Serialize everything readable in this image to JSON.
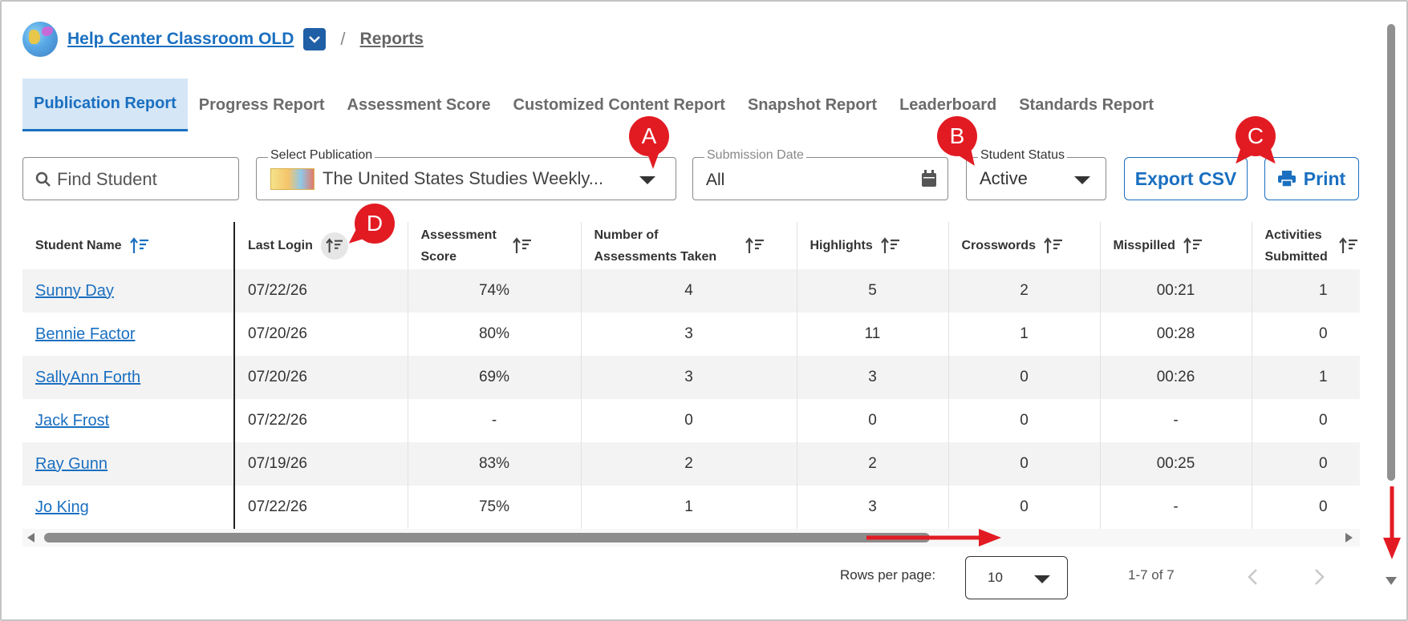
{
  "breadcrumb": {
    "classroom": "Help Center Classroom OLD",
    "separator": "/",
    "reports": "Reports"
  },
  "tabs": [
    {
      "label": "Publication Report",
      "active": true
    },
    {
      "label": "Progress Report"
    },
    {
      "label": "Assessment Score"
    },
    {
      "label": "Customized Content Report"
    },
    {
      "label": "Snapshot Report"
    },
    {
      "label": "Leaderboard"
    },
    {
      "label": "Standards Report"
    }
  ],
  "filters": {
    "search_placeholder": "Find Student",
    "publication_label": "Select Publication",
    "publication_value": "The United States Studies Weekly...",
    "date_label": "Submission Date",
    "date_value": "All",
    "status_label": "Student Status",
    "status_value": "Active"
  },
  "actions": {
    "export": "Export CSV",
    "print": "Print"
  },
  "table": {
    "headers": [
      "Student Name",
      "Last Login",
      "Assessment Score",
      "Number of Assessments Taken",
      "Highlights",
      "Crosswords",
      "Misspilled",
      "Activities Submitted"
    ],
    "rows": [
      [
        "Sunny Day",
        "07/22/26",
        "74%",
        "4",
        "5",
        "2",
        "00:21",
        "1"
      ],
      [
        "Bennie Factor",
        "07/20/26",
        "80%",
        "3",
        "11",
        "1",
        "00:28",
        "0"
      ],
      [
        "SallyAnn Forth",
        "07/20/26",
        "69%",
        "3",
        "3",
        "0",
        "00:26",
        "1"
      ],
      [
        "Jack Frost",
        "07/22/26",
        "-",
        "0",
        "0",
        "0",
        "-",
        "0"
      ],
      [
        "Ray Gunn",
        "07/19/26",
        "83%",
        "2",
        "2",
        "0",
        "00:25",
        "0"
      ],
      [
        "Jo King",
        "07/22/26",
        "75%",
        "1",
        "3",
        "0",
        "-",
        "0"
      ]
    ]
  },
  "pagination": {
    "rows_label": "Rows per page:",
    "rows_value": "10",
    "range": "1-7 of 7"
  },
  "callouts": {
    "a": "A",
    "b": "B",
    "c": "C",
    "d": "D"
  },
  "colors": {
    "accent": "#1a6fc0",
    "callout": "#e21b23",
    "active_tab_bg": "#d5e6f6"
  },
  "icons": {
    "search": "search-icon",
    "calendar": "calendar-icon",
    "printer": "printer-icon",
    "sort": "sort-icon",
    "chevron": "chevron-down-icon"
  }
}
